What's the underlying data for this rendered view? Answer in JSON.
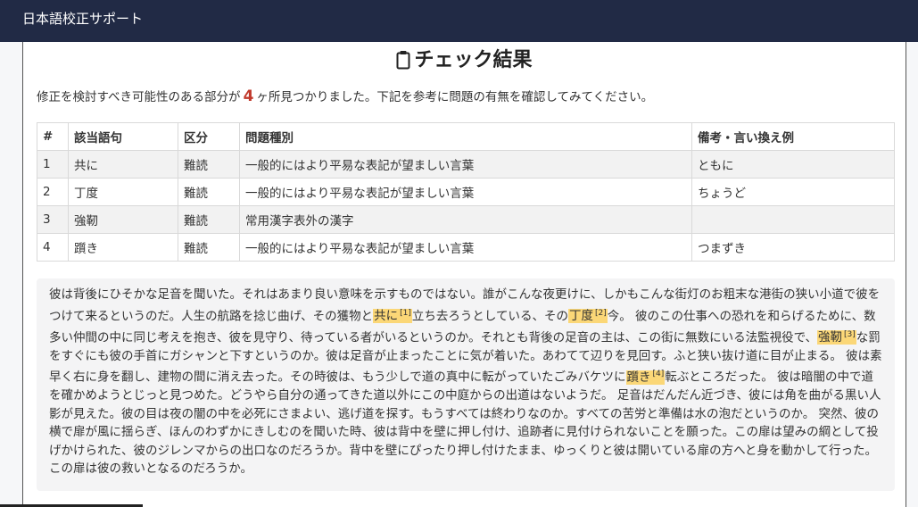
{
  "app": {
    "title": "日本語校正サポート"
  },
  "result": {
    "heading": "チェック結果",
    "summary_before": "修正を検討すべき可能性のある部分が",
    "count": "4",
    "summary_after": "ヶ所見つかりました。下記を参考に問題の有無を確認してみてください。"
  },
  "table": {
    "headers": [
      "#",
      "該当語句",
      "区分",
      "問題種別",
      "備考・言い換え例"
    ],
    "rows": [
      [
        "1",
        "共に",
        "難読",
        "一般的にはより平易な表記が望ましい言葉",
        "ともに"
      ],
      [
        "2",
        "丁度",
        "難読",
        "一般的にはより平易な表記が望ましい言葉",
        "ちょうど"
      ],
      [
        "3",
        "強靭",
        "難読",
        "常用漢字表外の漢字",
        ""
      ],
      [
        "4",
        "躓き",
        "難読",
        "一般的にはより平易な表記が望ましい言葉",
        "つまずき"
      ]
    ]
  },
  "text": {
    "p1": "彼は背後にひそかな足音を聞いた。それはあまり良い意味を示すものではない。誰がこんな夜更けに、しかもこんな街灯のお粗末な港街の狭い小道で彼をつけて来るというのだ。人生の航路を捻じ曲げ、その獲物と",
    "m1": "共に",
    "m1_ref": "[1]",
    "p2": "立ち去ろうとしている、その",
    "m2": "丁度",
    "m2_ref": "[2]",
    "p3": "今。 彼のこの仕事への恐れを和らげるために、数多い仲間の中に同じ考えを抱き、彼を見守り、待っている者がいるというのか。それとも背後の足音の主は、この街に無数にいる法監視役で、",
    "m3": "強靭",
    "m3_ref": "[3]",
    "p4": "な罰をすぐにも彼の手首にガシャンと下すというのか。彼は足音が止まったことに気が着いた。あわてて辺りを見回す。ふと狭い抜け道に目が止まる。 彼は素早く右に身を翻し、建物の間に消え去った。その時彼は、もう少しで道の真中に転がっていたごみバケツに",
    "m4": "躓き",
    "m4_ref": "[4]",
    "p5": "転ぶところだった。 彼は暗闇の中で道を確かめようとじっと見つめた。どうやら自分の通ってきた道以外にこの中庭からの出道はないようだ。 足音はだんだん近づき、彼には角を曲がる黒い人影が見えた。彼の目は夜の闇の中を必死にさまよい、逃げ道を探す。もうすべては終わりなのか。すべての苦労と準備は水の泡だというのか。 突然、彼の横で扉が風に揺らぎ、ほんのわずかにきしむのを聞いた時、彼は背中を壁に押し付け、追跡者に見付けられないことを願った。この扉は望みの綱として投げかけられた、彼のジレンマからの出口なのだろうか。背中を壁にぴったり押し付けたまま、ゆっくりと彼は開いている扉の方へと身を動かして行った。この扉は彼の救いとなるのだろうか。"
  },
  "colors": {
    "topbar": "#212a45",
    "highlight": "#fbd777",
    "count": "#c0392b"
  },
  "icons": {
    "heading": "clipboard-icon"
  }
}
